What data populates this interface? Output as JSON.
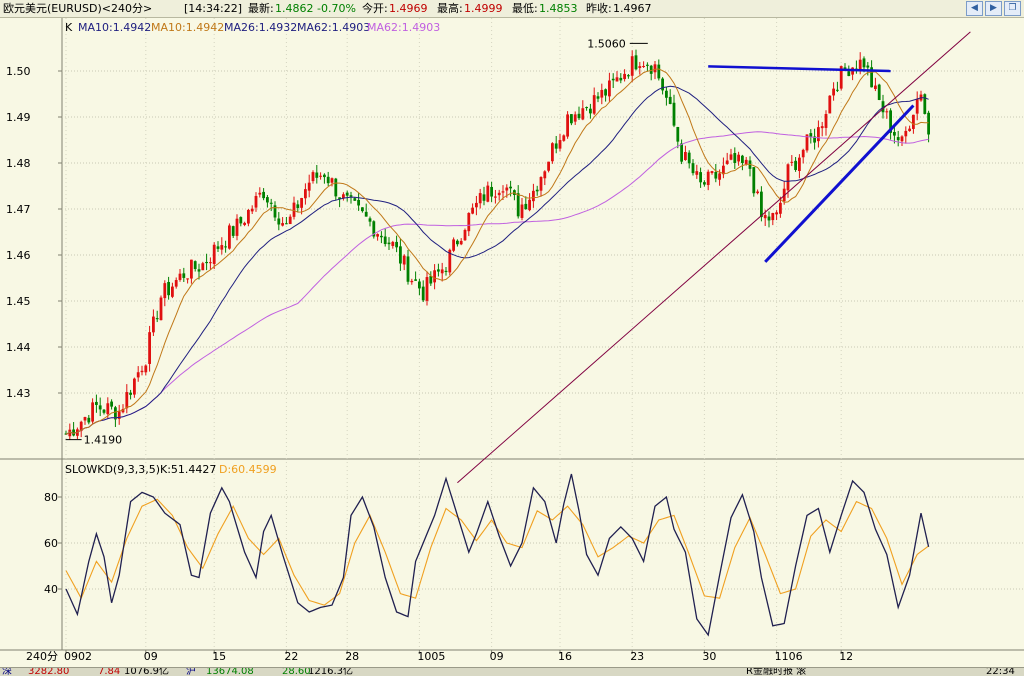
{
  "header": {
    "instrument": "欧元美元(EURUSD)<240分>",
    "time": "[14:34:22]",
    "last_label": "最新:",
    "last_value": "1.4862",
    "change": "-0.70%",
    "open_label": "今开:",
    "open_value": "1.4969",
    "high_label": "最高:",
    "high_value": "1.4999",
    "low_label": "最低:",
    "low_value": "1.4853",
    "prev_label": "昨收:",
    "prev_value": "1.4967",
    "nav_icons": [
      "arrow-left-icon",
      "arrow-right-icon",
      "restore-window-icon"
    ]
  },
  "colors": {
    "background": "#F8F8E4",
    "up_candle": "#E01010",
    "down_candle": "#008000",
    "ma10": "#C07818",
    "ma26": "#202080",
    "ma62": "#C060E0",
    "trendline": "#1010D0",
    "projection": "#800040",
    "slow_k": "#202050",
    "slow_d": "#F0A020"
  },
  "chart_data": [
    {
      "type": "candlestick",
      "title": "K",
      "legend": [
        {
          "text": "MA10:1.4942",
          "color": "#202080"
        },
        {
          "text": "MA10:1.4942",
          "color": "#C07818"
        },
        {
          "text": "MA26:1.4932",
          "color": "#202080"
        },
        {
          "text": "MA62:1.4903",
          "color": "#202080"
        },
        {
          "text": "MA62:1.4903",
          "color": "#C060E0"
        }
      ],
      "ylim": [
        1.418,
        1.506
      ],
      "y_ticks": [
        1.43,
        1.44,
        1.45,
        1.46,
        1.47,
        1.48,
        1.49,
        1.5
      ],
      "y_tick_labels": [
        "1.43",
        "1.44",
        "1.45",
        "1.46",
        "1.47",
        "1.48",
        "1.49",
        "1.50"
      ],
      "x_labels": [
        "0902",
        "09",
        "15",
        "22",
        "28",
        "1005",
        "09",
        "16",
        "23",
        "30",
        "1106",
        "12"
      ],
      "x_label_bars": [
        0,
        21,
        39,
        58,
        74,
        93,
        112,
        130,
        149,
        168,
        187,
        204
      ],
      "bar_count": 228,
      "grid": true,
      "anchors": [
        [
          0,
          1.421
        ],
        [
          8,
          1.427
        ],
        [
          14,
          1.426
        ],
        [
          21,
          1.438
        ],
        [
          25,
          1.451
        ],
        [
          31,
          1.456
        ],
        [
          36,
          1.458
        ],
        [
          40,
          1.462
        ],
        [
          46,
          1.467
        ],
        [
          52,
          1.474
        ],
        [
          58,
          1.466
        ],
        [
          64,
          1.476
        ],
        [
          68,
          1.478
        ],
        [
          73,
          1.472
        ],
        [
          80,
          1.467
        ],
        [
          86,
          1.462
        ],
        [
          91,
          1.455
        ],
        [
          94,
          1.452
        ],
        [
          100,
          1.458
        ],
        [
          105,
          1.467
        ],
        [
          110,
          1.473
        ],
        [
          115,
          1.476
        ],
        [
          119,
          1.47
        ],
        [
          123,
          1.474
        ],
        [
          128,
          1.483
        ],
        [
          132,
          1.49
        ],
        [
          138,
          1.493
        ],
        [
          143,
          1.496
        ],
        [
          147,
          1.5
        ],
        [
          151,
          1.503
        ],
        [
          155,
          1.501
        ],
        [
          158,
          1.494
        ],
        [
          162,
          1.482
        ],
        [
          167,
          1.475
        ],
        [
          171,
          1.477
        ],
        [
          175,
          1.48
        ],
        [
          180,
          1.479
        ],
        [
          183,
          1.468
        ],
        [
          187,
          1.468
        ],
        [
          190,
          1.478
        ],
        [
          194,
          1.483
        ],
        [
          198,
          1.487
        ],
        [
          202,
          1.497
        ],
        [
          206,
          1.501
        ],
        [
          210,
          1.502
        ],
        [
          213,
          1.495
        ],
        [
          217,
          1.488
        ],
        [
          220,
          1.484
        ],
        [
          223,
          1.492
        ],
        [
          225,
          1.496
        ],
        [
          227,
          1.4862
        ]
      ],
      "annotations": [
        {
          "text": "1.5060",
          "price": 1.506,
          "bar": 151
        },
        {
          "text": "1.4190",
          "price": 1.419,
          "bar": 2
        }
      ],
      "trendlines": [
        {
          "from": [
            169,
            1.501
          ],
          "to": [
            217,
            1.5
          ],
          "color": "#1010D0",
          "width": 2.5
        },
        {
          "from": [
            184,
            1.4585
          ],
          "to": [
            223,
            1.4925
          ],
          "color": "#1010D0",
          "width": 3
        },
        {
          "from": [
            103,
            1.4105
          ],
          "to": [
            238,
            1.5085
          ],
          "color": "#800040",
          "width": 1
        }
      ]
    },
    {
      "type": "line",
      "title": "SLOWKD(9,3,3,5)",
      "series": [
        {
          "name": "K",
          "last": "K:51.4427",
          "color": "#202050"
        },
        {
          "name": "D",
          "last": "D:60.4599",
          "color": "#F0A020"
        }
      ],
      "ylim": [
        20,
        90
      ],
      "y_ticks": [
        40,
        60,
        80
      ],
      "y_tick_labels": [
        "40",
        "60",
        "80"
      ],
      "k_anchors": [
        [
          0,
          40
        ],
        [
          3,
          29
        ],
        [
          6,
          52
        ],
        [
          8,
          64
        ],
        [
          10,
          54
        ],
        [
          12,
          34
        ],
        [
          14,
          46
        ],
        [
          17,
          78
        ],
        [
          20,
          82
        ],
        [
          23,
          80
        ],
        [
          26,
          73
        ],
        [
          30,
          68
        ],
        [
          33,
          46
        ],
        [
          35,
          45
        ],
        [
          38,
          73
        ],
        [
          41,
          84
        ],
        [
          43,
          78
        ],
        [
          47,
          56
        ],
        [
          50,
          45
        ],
        [
          52,
          65
        ],
        [
          54,
          72
        ],
        [
          57,
          55
        ],
        [
          61,
          34
        ],
        [
          64,
          30
        ],
        [
          67,
          32
        ],
        [
          70,
          33
        ],
        [
          73,
          45
        ],
        [
          75,
          72
        ],
        [
          78,
          80
        ],
        [
          81,
          67
        ],
        [
          84,
          45
        ],
        [
          87,
          30
        ],
        [
          90,
          28
        ],
        [
          92,
          52
        ],
        [
          94,
          60
        ],
        [
          97,
          72
        ],
        [
          100,
          88
        ],
        [
          103,
          72
        ],
        [
          106,
          56
        ],
        [
          108,
          64
        ],
        [
          111,
          78
        ],
        [
          114,
          63
        ],
        [
          117,
          50
        ],
        [
          120,
          60
        ],
        [
          123,
          84
        ],
        [
          126,
          78
        ],
        [
          129,
          60
        ],
        [
          131,
          77
        ],
        [
          133,
          90
        ],
        [
          135,
          74
        ],
        [
          137,
          55
        ],
        [
          140,
          46
        ],
        [
          143,
          62
        ],
        [
          146,
          67
        ],
        [
          149,
          62
        ],
        [
          152,
          52
        ],
        [
          155,
          76
        ],
        [
          158,
          80
        ],
        [
          160,
          66
        ],
        [
          163,
          56
        ],
        [
          166,
          27
        ],
        [
          169,
          20
        ],
        [
          172,
          46
        ],
        [
          175,
          71
        ],
        [
          178,
          81
        ],
        [
          181,
          65
        ],
        [
          183,
          45
        ],
        [
          186,
          24
        ],
        [
          189,
          25
        ],
        [
          192,
          50
        ],
        [
          195,
          72
        ],
        [
          198,
          75
        ],
        [
          201,
          56
        ],
        [
          204,
          72
        ],
        [
          207,
          87
        ],
        [
          210,
          82
        ],
        [
          213,
          66
        ],
        [
          216,
          55
        ],
        [
          219,
          32
        ],
        [
          222,
          46
        ],
        [
          225,
          73
        ],
        [
          228,
          51
        ]
      ],
      "d_anchors": [
        [
          0,
          48
        ],
        [
          4,
          36
        ],
        [
          8,
          52
        ],
        [
          12,
          43
        ],
        [
          16,
          62
        ],
        [
          20,
          76
        ],
        [
          24,
          79
        ],
        [
          28,
          72
        ],
        [
          32,
          58
        ],
        [
          36,
          49
        ],
        [
          40,
          64
        ],
        [
          44,
          76
        ],
        [
          48,
          62
        ],
        [
          52,
          55
        ],
        [
          56,
          62
        ],
        [
          60,
          46
        ],
        [
          64,
          35
        ],
        [
          68,
          33
        ],
        [
          72,
          38
        ],
        [
          76,
          60
        ],
        [
          80,
          72
        ],
        [
          84,
          56
        ],
        [
          88,
          38
        ],
        [
          92,
          36
        ],
        [
          96,
          58
        ],
        [
          100,
          75
        ],
        [
          104,
          70
        ],
        [
          108,
          61
        ],
        [
          112,
          70
        ],
        [
          116,
          60
        ],
        [
          120,
          58
        ],
        [
          124,
          74
        ],
        [
          128,
          70
        ],
        [
          132,
          76
        ],
        [
          136,
          68
        ],
        [
          140,
          54
        ],
        [
          144,
          58
        ],
        [
          148,
          63
        ],
        [
          152,
          60
        ],
        [
          156,
          70
        ],
        [
          160,
          72
        ],
        [
          164,
          55
        ],
        [
          168,
          37
        ],
        [
          172,
          36
        ],
        [
          176,
          58
        ],
        [
          180,
          71
        ],
        [
          184,
          55
        ],
        [
          188,
          38
        ],
        [
          192,
          40
        ],
        [
          196,
          63
        ],
        [
          200,
          70
        ],
        [
          204,
          65
        ],
        [
          208,
          78
        ],
        [
          212,
          75
        ],
        [
          216,
          62
        ],
        [
          220,
          42
        ],
        [
          224,
          55
        ],
        [
          228,
          60
        ]
      ]
    }
  ],
  "x_axis": {
    "period_label": "240分"
  },
  "status_bar": {
    "items": [
      {
        "text": "深",
        "color": "#000080"
      },
      {
        "text": "3282.80",
        "color": "#C00000"
      },
      {
        "text": "7.84",
        "color": "#C00000"
      },
      {
        "text": "1076.9亿",
        "color": "#000000"
      },
      {
        "text": "沪",
        "color": "#000080"
      },
      {
        "text": "13674.08",
        "color": "#008000"
      },
      {
        "text": "28.60",
        "color": "#008000"
      },
      {
        "text": "1216.3亿",
        "color": "#000000"
      },
      {
        "text": "R金融时报 滚",
        "color": "#000000"
      },
      {
        "text": "22:34",
        "color": "#000000"
      }
    ]
  }
}
